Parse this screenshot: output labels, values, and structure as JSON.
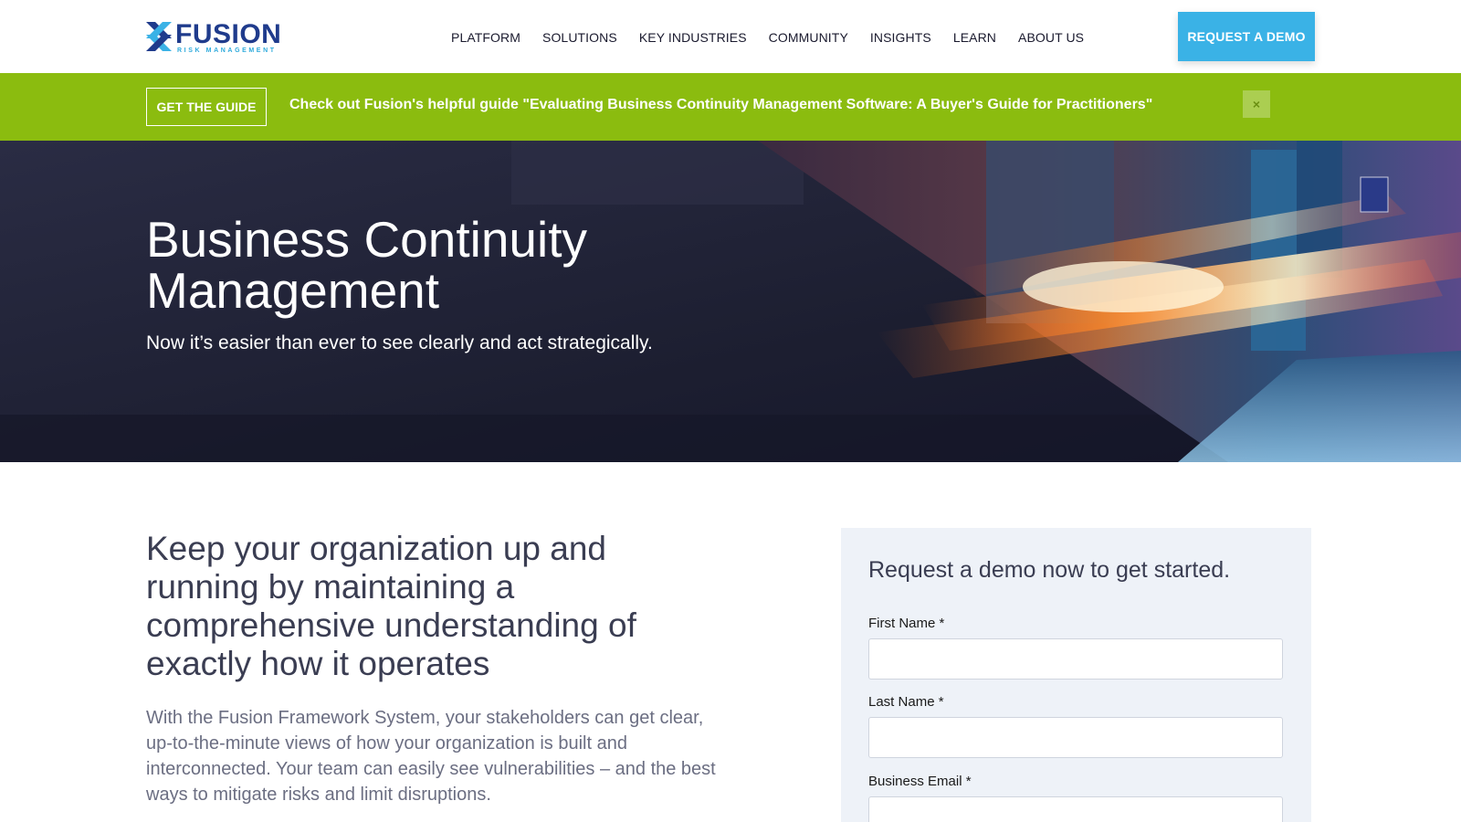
{
  "header": {
    "logo": {
      "word": "FUSION",
      "sub": "RISK MANAGEMENT"
    },
    "nav": [
      "PLATFORM",
      "SOLUTIONS",
      "KEY INDUSTRIES",
      "COMMUNITY",
      "INSIGHTS",
      "LEARN",
      "ABOUT US"
    ],
    "demo_button": "REQUEST A DEMO"
  },
  "banner": {
    "button": "GET THE GUIDE",
    "text": "Check out Fusion's helpful guide \"Evaluating Business Continuity Management Software: A Buyer's Guide for Practitioners\"",
    "close": "×"
  },
  "hero": {
    "title": "Business Continuity Management",
    "subtitle": "Now it’s easier than ever to see clearly and act strategically."
  },
  "content": {
    "title": "Keep your organization up and running by maintaining a comprehensive understanding of exactly how it operates",
    "body": "With the Fusion Framework System, your stakeholders can get clear, up-to-the-minute views of how your organization is built and interconnected. Your team can easily see vulnerabilities – and the best ways to mitigate risks and limit disruptions."
  },
  "form": {
    "title": "Request a demo now to get started.",
    "fields": [
      {
        "label": "First Name *",
        "value": ""
      },
      {
        "label": "Last Name *",
        "value": ""
      },
      {
        "label": "Business Email *",
        "value": ""
      }
    ]
  },
  "colors": {
    "brand_navy": "#1f3b8c",
    "brand_blue": "#3ab2e6",
    "banner_green": "#8bbc0f",
    "hero_dark": "#1d1f33",
    "form_bg": "#eef2f8"
  },
  "icons": {
    "logo_mark": "fusion-x-logo-icon",
    "close": "close-icon"
  }
}
